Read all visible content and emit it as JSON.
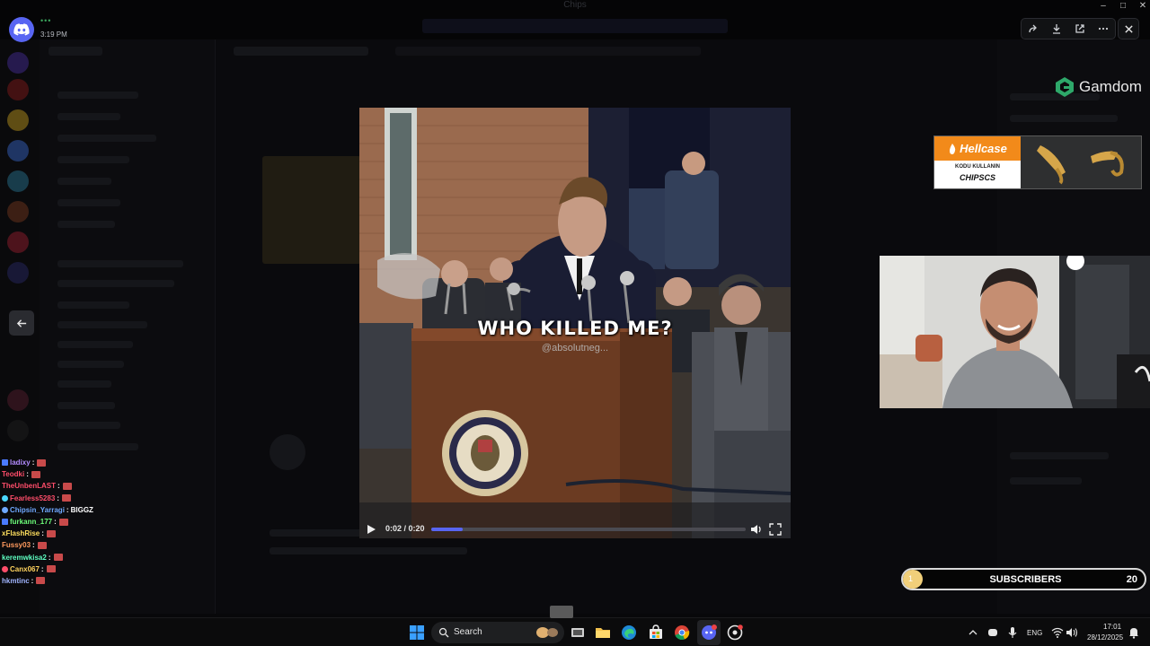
{
  "window": {
    "title": "Chips",
    "time": "3:19 PM",
    "status_dots": "•••",
    "controls": [
      "–",
      "□",
      "✕"
    ]
  },
  "viewer": {
    "tools": [
      "forward-icon",
      "download-icon",
      "open-external-icon",
      "more-icon"
    ],
    "close_icon": "close-icon"
  },
  "video": {
    "caption": "WHO KILLED ME?",
    "watermark": "@absolutneg...",
    "current_time": "0:02",
    "duration": "0:20",
    "time_readout": "0:02 / 0:20",
    "progress": 0.1,
    "accent_color": "#5865f2"
  },
  "overlays": {
    "gamdom": "Gamdom",
    "hellcase_brand": "Hellcase",
    "hellcase_line1": "KODU KULLANIN",
    "hellcase_code": "CHIPSCS",
    "subscribers_label": "SUBSCRIBERS",
    "subscribers_count": "20",
    "subscribers_badge": "1",
    "subscribers_progress": 0.08
  },
  "chat": [
    {
      "user": "ladixy",
      "color": "#b38cff",
      "message": ""
    },
    {
      "user": "Teodki",
      "color": "#ff4d6a",
      "message": ""
    },
    {
      "user": "TheUnbenLAST",
      "color": "#ff4d6a",
      "message": ""
    },
    {
      "user": "Fearless5283",
      "color": "#ff4d6a",
      "message": ""
    },
    {
      "user": "Chipsin_Yarragi",
      "color": "#6fa8ff",
      "message": "BIGGZ"
    },
    {
      "user": "furkann_177",
      "color": "#6dff7a",
      "message": ""
    },
    {
      "user": "xFlashRise",
      "color": "#ffdf5e",
      "message": ""
    },
    {
      "user": "Fussy03",
      "color": "#ff9a5e",
      "message": ""
    },
    {
      "user": "keremwkisa2",
      "color": "#5effc2",
      "message": ""
    },
    {
      "user": "Canx067",
      "color": "#ffd35e",
      "message": ""
    },
    {
      "user": "hkmtinc",
      "color": "#a0b4ff",
      "message": ""
    }
  ],
  "taskbar": {
    "search_placeholder": "Search",
    "language": "ENG",
    "clock_time": "17:01",
    "clock_date": "28/12/2025"
  }
}
